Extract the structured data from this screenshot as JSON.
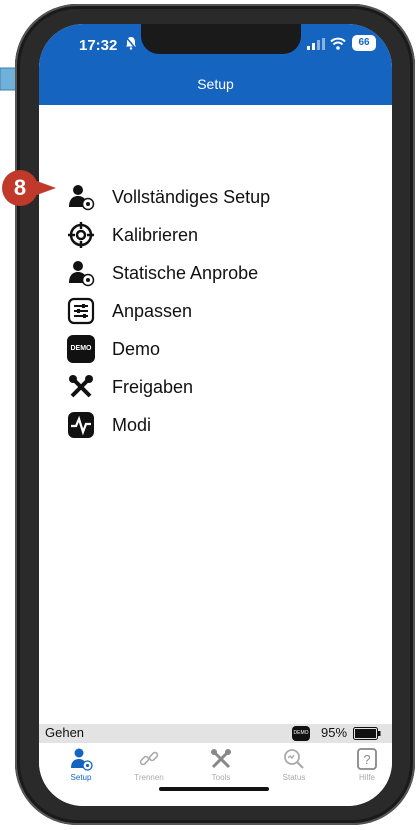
{
  "status_bar": {
    "time": "17:32",
    "battery": "66"
  },
  "navbar": {
    "title": "Setup"
  },
  "callout": {
    "number": "8"
  },
  "menu": {
    "items": [
      {
        "label": "Vollständiges Setup",
        "icon": "person-gear-icon"
      },
      {
        "label": "Kalibrieren",
        "icon": "crosshair-icon"
      },
      {
        "label": "Statische Anprobe",
        "icon": "person-gear-icon"
      },
      {
        "label": "Anpassen",
        "icon": "sliders-icon"
      },
      {
        "label": "Demo",
        "icon": "demo-badge-icon",
        "badge_text": "DEMO"
      },
      {
        "label": "Freigaben",
        "icon": "tools-icon"
      },
      {
        "label": "Modi",
        "icon": "pulse-icon"
      }
    ]
  },
  "bottom_status": {
    "connection": "Gehen",
    "demo_badge": "DEMO",
    "battery_percent": "95%"
  },
  "tabbar": {
    "tabs": [
      {
        "label": "Setup",
        "active": true
      },
      {
        "label": "Trennen",
        "active": false
      },
      {
        "label": "Tools",
        "active": false
      },
      {
        "label": "Status",
        "active": false
      },
      {
        "label": "Hilfe",
        "active": false
      }
    ]
  },
  "colors": {
    "accent": "#1565c0",
    "callout": "#c0392b",
    "pointer": "#6fb1d8"
  }
}
